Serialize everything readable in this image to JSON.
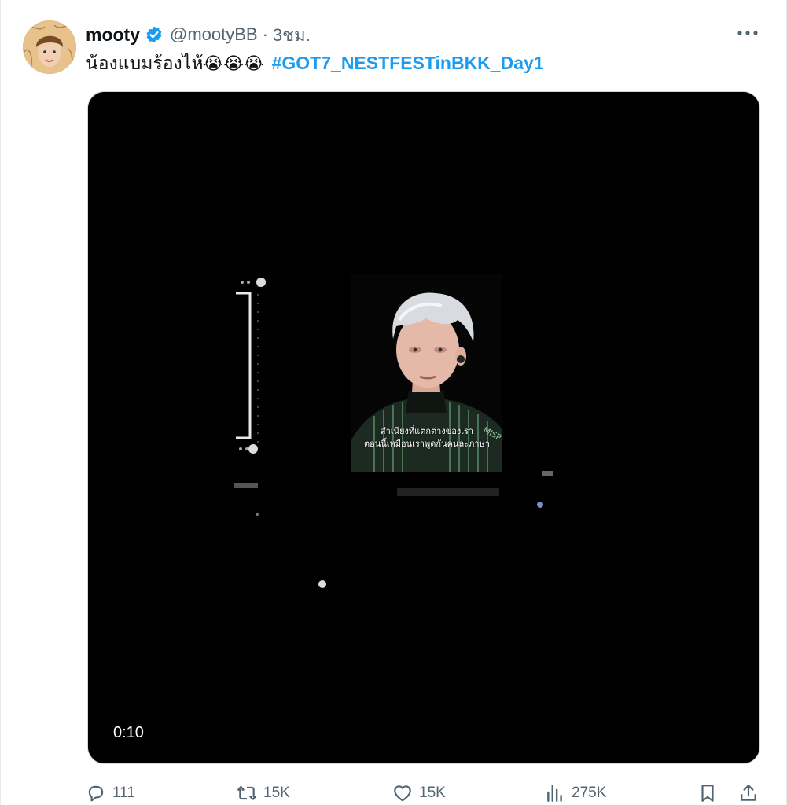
{
  "tweet": {
    "author_name": "mooty",
    "handle": "@mootyBB",
    "separator": "·",
    "time": "3ชม.",
    "text": "น้องแบมร้องไห้",
    "emojis": "😭😭😭",
    "hashtag": "#GOT7_NESTFESTinBKK_Day1",
    "verified": true
  },
  "media": {
    "type": "video",
    "duration": "0:10",
    "subtitle_line1": "สำเนียงที่แตกต่างของเรา",
    "subtitle_line2": "ตอนนี้เหมือนเราพูดกันคนละภาษา"
  },
  "actions": {
    "replies": "111",
    "reposts": "15K",
    "likes": "15K",
    "views": "275K"
  },
  "colors": {
    "link": "#1d9bf0",
    "muted": "#536471",
    "verified": "#1d9bf0"
  },
  "icons": [
    "verified-badge-icon",
    "more-options-icon",
    "reply-icon",
    "repost-icon",
    "like-icon",
    "views-icon",
    "bookmark-icon",
    "share-icon"
  ]
}
